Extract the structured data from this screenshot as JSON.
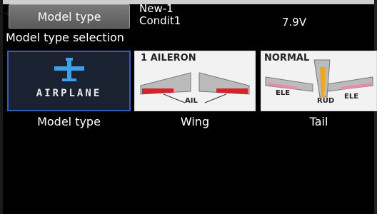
{
  "header": {
    "title_button": "Model type",
    "model_name": "New-1",
    "condition": "Condit1",
    "voltage": "7.9V"
  },
  "section_label": "Model type selection",
  "tiles": [
    {
      "icon_text": "AIRPLANE",
      "caption": "Model type"
    },
    {
      "header": "1 AILERON",
      "part_label": "AIL",
      "caption": "Wing"
    },
    {
      "header": "NORMAL",
      "labels": [
        "ELE",
        "RUD",
        "ELE"
      ],
      "caption": "Tail"
    }
  ],
  "colors": {
    "selection_border": "#2f5fb6",
    "airplane_icon": "#3fa0e6",
    "aileron": "#d4232a",
    "elevator": "#e889b0",
    "rudder": "#f0a818"
  },
  "icons": [
    "pointer-arrow-icon",
    "airplane-icon"
  ]
}
